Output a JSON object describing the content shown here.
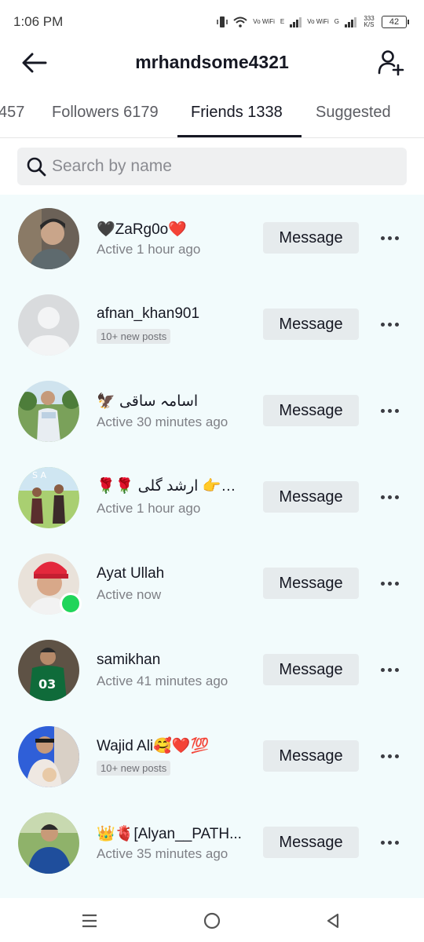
{
  "status_bar": {
    "time": "1:06 PM",
    "net1_label": "Vo WiFi",
    "net1_type": "E",
    "net2_label": "Vo WiFi",
    "net2_type": "G",
    "speed": "333 K/S",
    "battery": "42"
  },
  "header": {
    "title": "mrhandsome4321",
    "back_icon": "arrow-left-icon",
    "add_icon": "add-user-icon"
  },
  "tabs": [
    {
      "label": "457",
      "active": false
    },
    {
      "label": "Followers 6179",
      "active": false
    },
    {
      "label": "Friends 1338",
      "active": true
    },
    {
      "label": "Suggested",
      "active": false
    }
  ],
  "search": {
    "placeholder": "Search by name"
  },
  "friends": [
    {
      "name": "🖤ZaRg0o❤️",
      "status": "Active 1 hour ago",
      "badge": null,
      "online": false,
      "button": "Message"
    },
    {
      "name": "afnan_khan901",
      "status": null,
      "badge": "10+ new posts",
      "online": false,
      "button": "Message"
    },
    {
      "name": "🦅 اسامہ ساقی",
      "status": "Active 30 minutes ago",
      "badge": null,
      "online": false,
      "button": "Message"
    },
    {
      "name": "🌹🌹 ارشد گلی 👉❤️👈",
      "status": "Active 1 hour ago",
      "badge": null,
      "online": false,
      "button": "Message"
    },
    {
      "name": "Ayat Ullah",
      "status": "Active now",
      "badge": null,
      "online": true,
      "button": "Message"
    },
    {
      "name": "samikhan",
      "status": "Active 41 minutes ago",
      "badge": null,
      "online": false,
      "button": "Message"
    },
    {
      "name": "Wajid Ali🥰❤️💯",
      "status": null,
      "badge": "10+ new posts",
      "online": false,
      "button": "Message"
    },
    {
      "name": "👑🫀[Alyan__PATH...",
      "status": "Active 35 minutes ago",
      "badge": null,
      "online": false,
      "button": "Message"
    }
  ],
  "colors": {
    "online": "#20d55a",
    "list_bg": "#f2fbfc",
    "button_bg": "#e6ebed"
  },
  "navbar": {
    "icons": [
      "menu-icon",
      "home-circle-icon",
      "back-triangle-icon"
    ]
  }
}
